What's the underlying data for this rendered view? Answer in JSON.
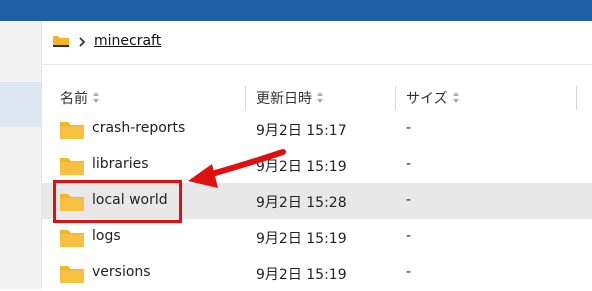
{
  "breadcrumb": {
    "folder_icon": "folder-icon",
    "separator_icon": "chevron-right-icon",
    "path": "minecraft"
  },
  "columns": [
    {
      "label": "名前"
    },
    {
      "label": "更新日時"
    },
    {
      "label": "サイズ"
    }
  ],
  "files": [
    {
      "name": "crash-reports",
      "modified": "9月2日 15:17",
      "size": "-"
    },
    {
      "name": "libraries",
      "modified": "9月2日 15:19",
      "size": "-"
    },
    {
      "name": "local world",
      "modified": "9月2日 15:28",
      "size": "-"
    },
    {
      "name": "logs",
      "modified": "9月2日 15:19",
      "size": "-"
    },
    {
      "name": "versions",
      "modified": "9月2日 15:19",
      "size": "-"
    }
  ],
  "colors": {
    "titlebar": "#1e5fa6",
    "folder": "#f5b326",
    "highlight_row": "#e8e8e8",
    "annotation": "#e01010"
  }
}
